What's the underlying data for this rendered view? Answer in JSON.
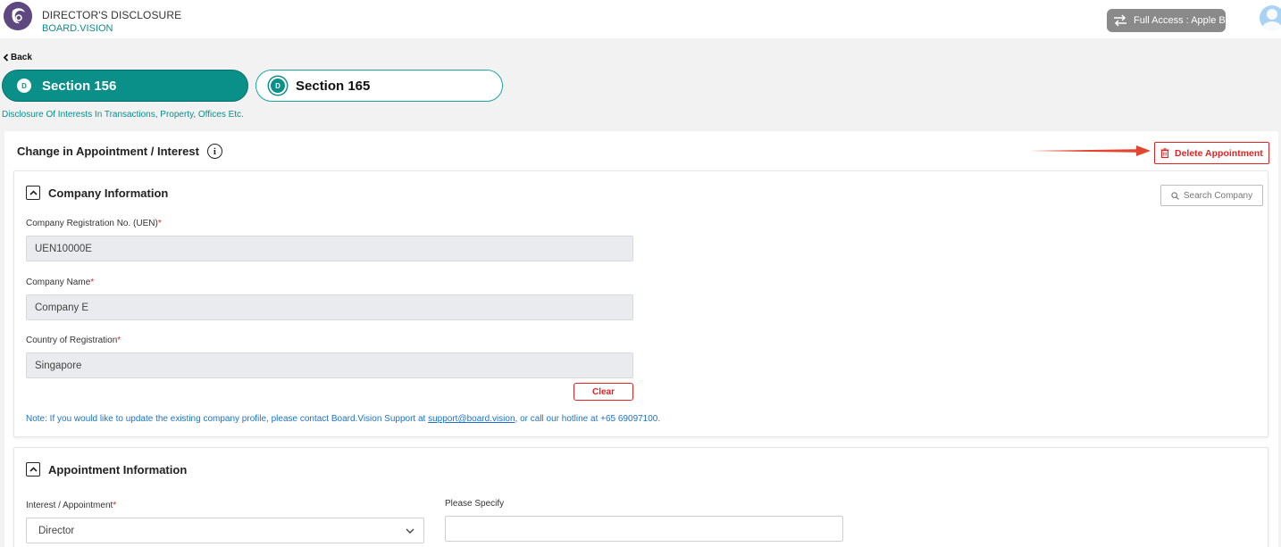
{
  "header": {
    "app_title": "DIRECTOR'S DISCLOSURE",
    "app_subtitle": "BOARD.VISION",
    "access_label": "Full Access : Apple B"
  },
  "nav": {
    "back_label": "Back",
    "tabs": [
      {
        "badge": "D",
        "label": "Section 156",
        "active": true
      },
      {
        "badge": "D",
        "label": "Section 165",
        "active": false
      }
    ],
    "subtitle": "Disclosure Of Interests In Transactions, Property, Offices Etc."
  },
  "main": {
    "title": "Change in Appointment / Interest",
    "info_glyph": "i",
    "delete_label": "Delete Appointment"
  },
  "company_section": {
    "title": "Company Information",
    "search_label": "Search Company",
    "fields": [
      {
        "label": "Company Registration No. (UEN)",
        "required": "*",
        "value": "UEN10000E"
      },
      {
        "label": "Company Name",
        "required": "*",
        "value": "Company E"
      },
      {
        "label": "Country of Registration",
        "required": "*",
        "value": "Singapore"
      }
    ],
    "clear_label": "Clear",
    "note_prefix": "Note: If you would like to update the existing company profile, please contact Board.Vision Support at ",
    "note_email": "support@board.vision",
    "note_suffix": ", or call our hotline at +65 69097100."
  },
  "appointment_section": {
    "title": "Appointment Information",
    "interest_label": "Interest / Appointment",
    "interest_required": "*",
    "interest_value": "Director",
    "specify_label": "Please Specify",
    "specify_value": ""
  },
  "colors": {
    "teal": "#0a9088",
    "red": "#e02424",
    "link_blue": "#1a73c9",
    "logo_purple": "#5d4880"
  },
  "icons": [
    "logo-icon",
    "swap-icon",
    "avatar-icon",
    "chevron-left-icon",
    "info-icon",
    "trash-icon",
    "collapse-icon",
    "search-icon",
    "chevron-down-icon",
    "arrow-icon"
  ]
}
